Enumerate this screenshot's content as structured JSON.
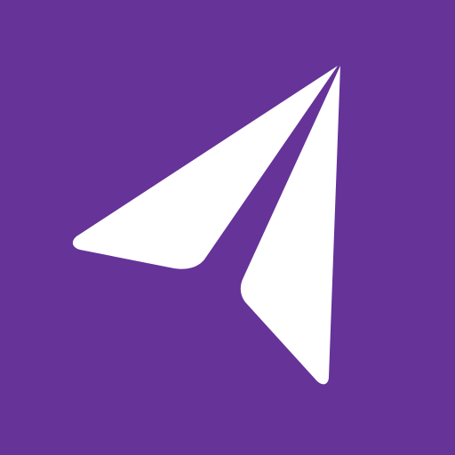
{
  "icon": {
    "name": "paper-plane-icon",
    "background_color": "#663399",
    "foreground_color": "#ffffff"
  }
}
